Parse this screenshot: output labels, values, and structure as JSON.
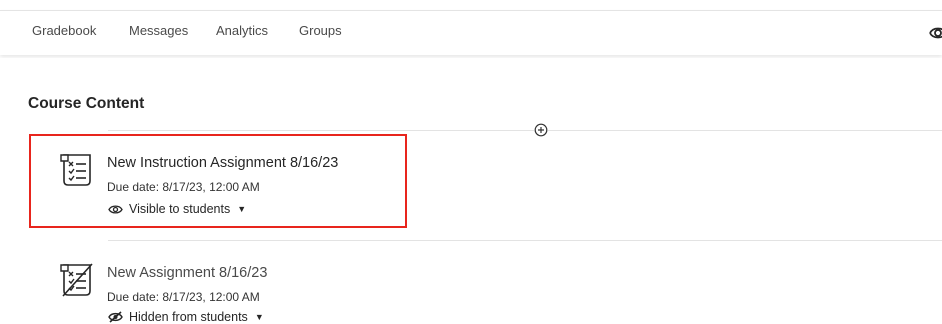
{
  "nav": {
    "items": [
      "Gradebook",
      "Messages",
      "Analytics",
      "Groups"
    ],
    "right_icon": "student-preview-icon"
  },
  "content": {
    "title": "Course Content",
    "add_icon": "plus-circle-icon",
    "items": [
      {
        "icon": "assignment-icon",
        "title": "New Instruction Assignment 8/16/23",
        "due": "Due date: 8/17/23, 12:00 AM",
        "visibility": "Visible to students",
        "visibility_icon": "eye-icon",
        "highlighted": true
      },
      {
        "icon": "assignment-hidden-icon",
        "title": "New Assignment 8/16/23",
        "due": "Due date: 8/17/23, 12:00 AM",
        "visibility": "Hidden from students",
        "visibility_icon": "eye-slash-icon",
        "highlighted": false
      }
    ]
  },
  "colors": {
    "highlight": "#e8251d",
    "text": "#262626",
    "muted_text": "#4a4a4a"
  }
}
